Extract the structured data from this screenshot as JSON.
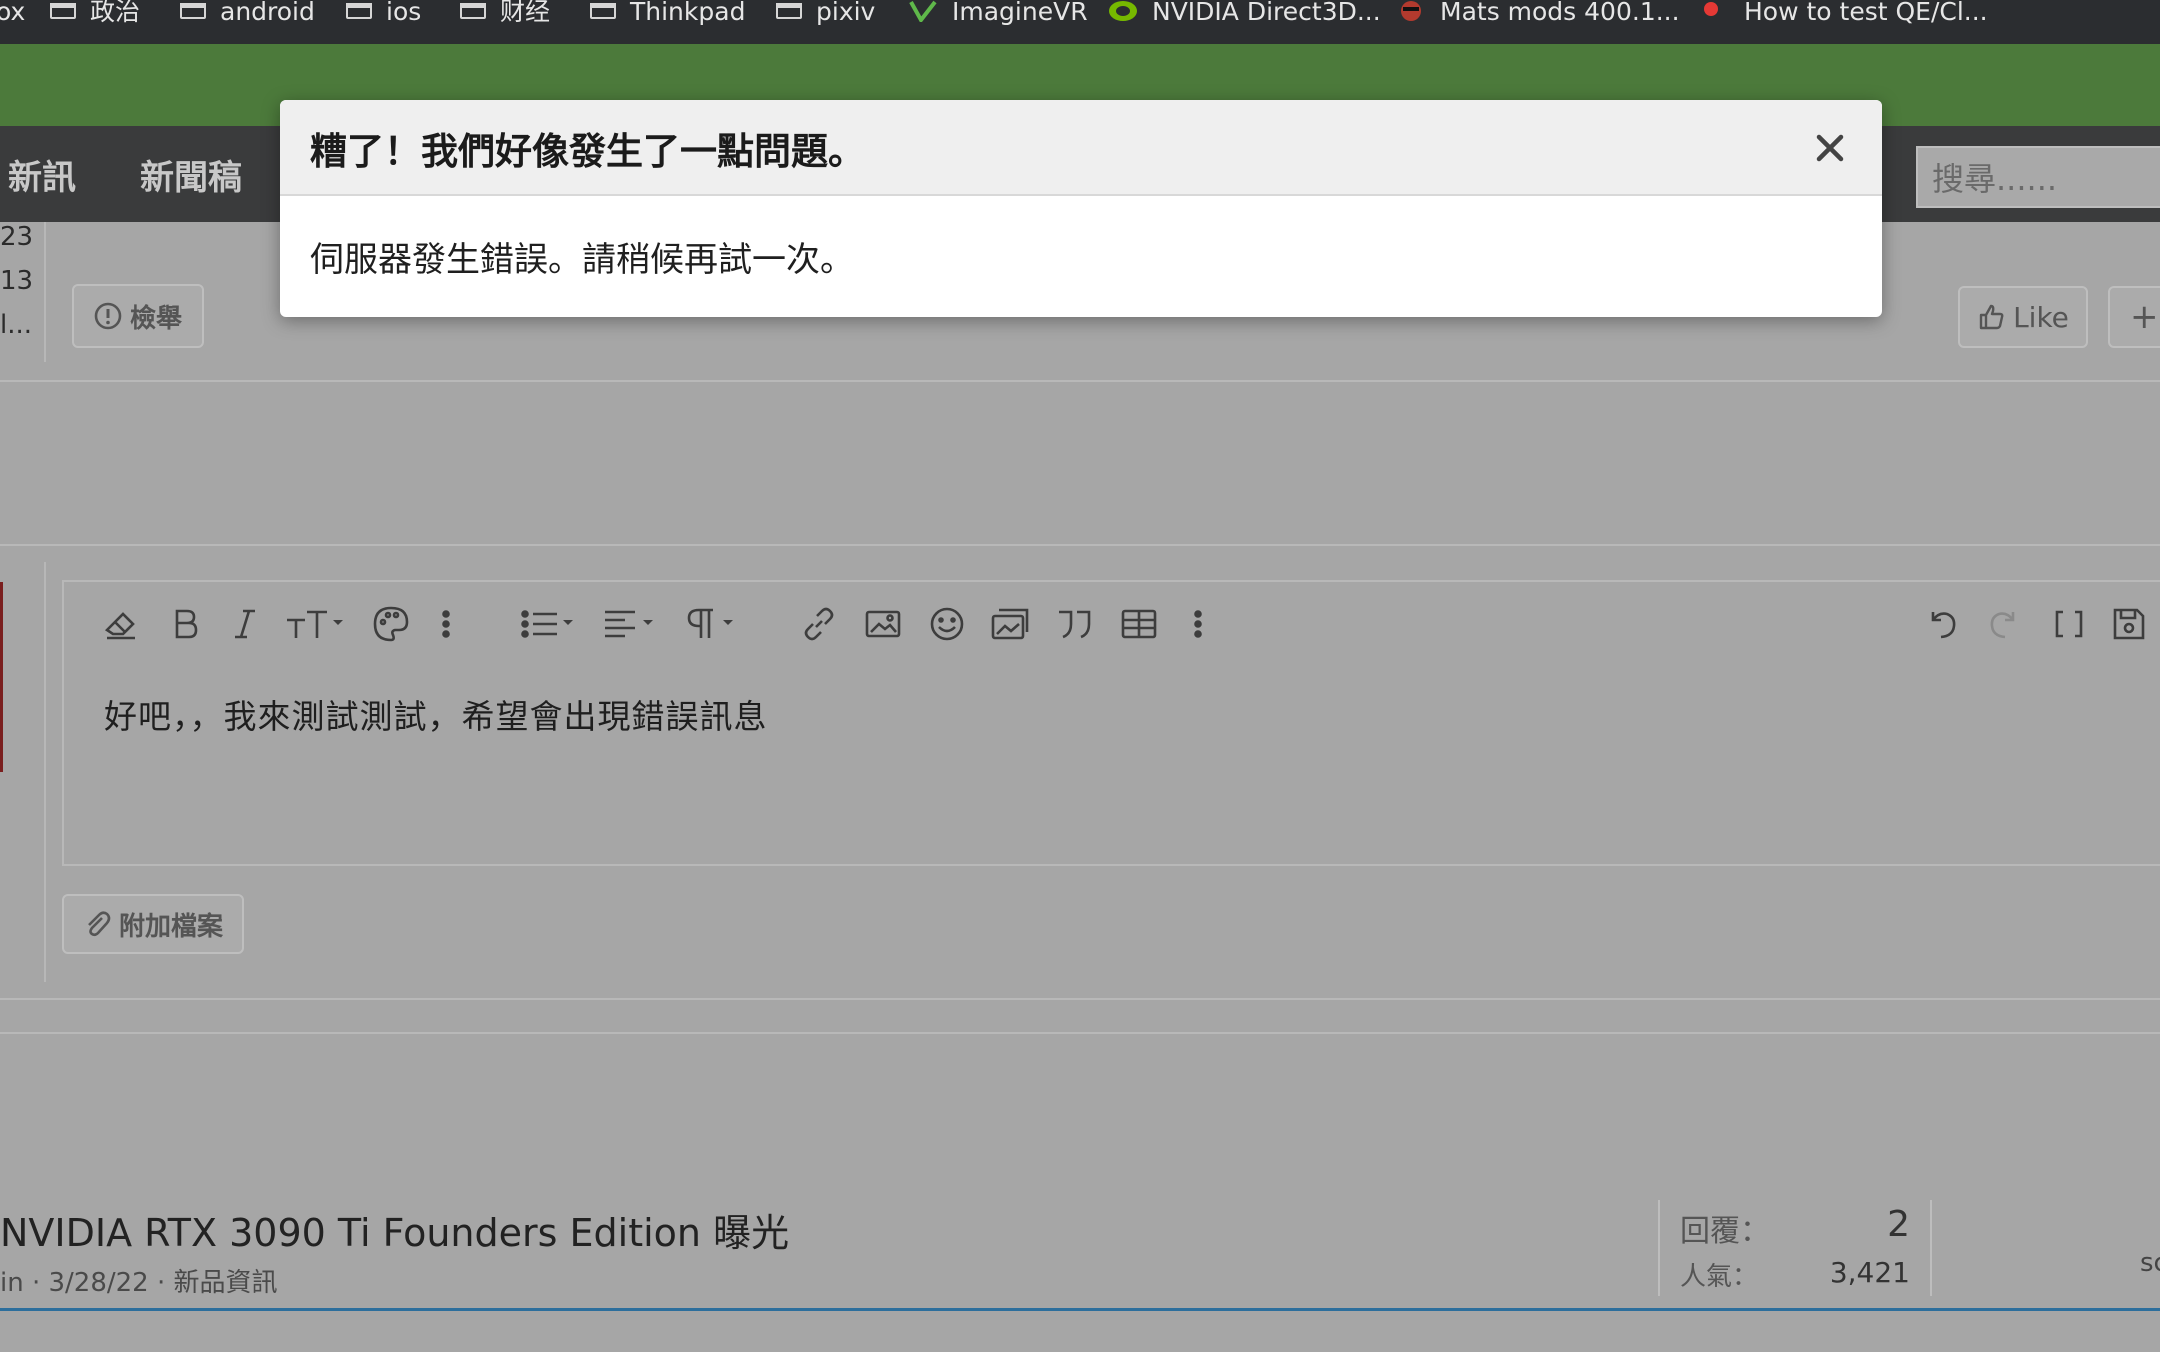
{
  "bookmarks": [
    {
      "label": "ox",
      "icon": "none"
    },
    {
      "label": "政治",
      "icon": "folder-icon"
    },
    {
      "label": "android",
      "icon": "folder-icon"
    },
    {
      "label": "ios",
      "icon": "folder-icon"
    },
    {
      "label": "财经",
      "icon": "folder-icon"
    },
    {
      "label": "Thinkpad",
      "icon": "folder-icon"
    },
    {
      "label": "pixiv",
      "icon": "folder-icon"
    },
    {
      "label": "ImagineVR",
      "icon": "imaginevr-icon"
    },
    {
      "label": "NVIDIA Direct3D...",
      "icon": "nvidia-icon"
    },
    {
      "label": "Mats mods 400.1...",
      "icon": "mats-mods-icon"
    },
    {
      "label": "How to test QE/Cl...",
      "icon": "apple-icon"
    }
  ],
  "nav": {
    "items": [
      "新訊",
      "新聞稿"
    ],
    "search_placeholder": "搜尋......"
  },
  "left_column": {
    "lines": [
      "23",
      "13",
      "l..."
    ]
  },
  "post_actions": {
    "report_label": "檢舉",
    "like_label": "Like",
    "more_label": "+"
  },
  "editor": {
    "toolbar_icons": [
      "eraser-icon",
      "bold-icon",
      "italic-icon",
      "text-size-icon",
      "palette-icon",
      "more-vertical-icon",
      "list-icon",
      "align-icon",
      "paragraph-icon",
      "link-icon",
      "image-icon",
      "smile-icon",
      "media-icon",
      "quote-icon",
      "table-icon",
      "more-vertical-icon",
      "undo-icon",
      "redo-icon",
      "brackets-icon",
      "save-draft-icon"
    ],
    "content": "好吧，，我來測試測試，希望會出現錯誤訊息",
    "attach_label": "附加檔案"
  },
  "thread": {
    "title": "NVIDIA RTX 3090 Ti Founders Edition 曝光",
    "meta": "in · 3/28/22 · 新品資訊",
    "replies_label": "回覆：",
    "replies_value": "2",
    "views_label": "人氣：",
    "views_value": "3,421",
    "edge_text": "sc"
  },
  "modal": {
    "title": "糟了！我們好像發生了一點問題。",
    "message": "伺服器發生錯誤。請稍候再試一次。"
  },
  "colors": {
    "banner_green": "#4c7a3b",
    "nav_dark": "#3a3b3c",
    "overlay_gray": "#a6a6a6",
    "link_blue": "#2c6e9c"
  }
}
